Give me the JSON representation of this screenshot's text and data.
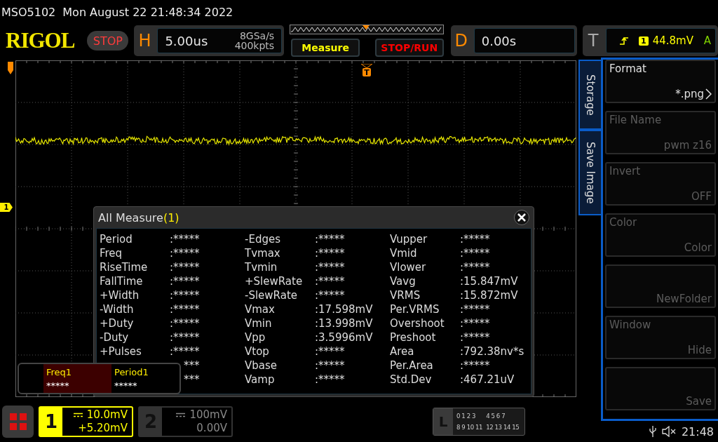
{
  "title_bar": {
    "model": "MSO5102",
    "datetime": "Mon August 22 21:48:34 2022"
  },
  "header": {
    "logo": "RIGOL",
    "run_state": "STOP",
    "horizontal": {
      "label": "H",
      "timebase": "5.00us",
      "sample_rate": "8GSa/s",
      "memory_depth": "400kpts"
    },
    "buttons": [
      {
        "label": "Measure",
        "color": "#ffff00"
      },
      {
        "label": "STOP/RUN",
        "color": "#ff0000"
      }
    ],
    "delay": {
      "label": "D",
      "value": "0.00s"
    },
    "trigger": {
      "label": "T",
      "source": "1",
      "trigger_level": "44.8mV",
      "mode": "A"
    }
  },
  "screen": {
    "trigger_marker": "T",
    "channel_marker": "1"
  },
  "measure_dialog": {
    "title": "All Measure",
    "count": "(1)",
    "columns": [
      [
        {
          "label": "Period",
          "value": ":*****"
        },
        {
          "label": "Freq",
          "value": ":*****"
        },
        {
          "label": "RiseTime",
          "value": ":*****"
        },
        {
          "label": "FallTime",
          "value": ":*****"
        },
        {
          "label": "+Width",
          "value": ":*****"
        },
        {
          "label": "-Width",
          "value": ":*****"
        },
        {
          "label": "+Duty",
          "value": ":*****"
        },
        {
          "label": "-Duty",
          "value": ":*****"
        },
        {
          "label": "+Pulses",
          "value": ":*****"
        },
        {
          "value": "***"
        },
        {
          "value": "***"
        }
      ],
      [
        {
          "label": "-Edges",
          "value": ":*****"
        },
        {
          "label": "Tvmax",
          "value": ":*****"
        },
        {
          "label": "Tvmin",
          "value": ":*****"
        },
        {
          "label": "+SlewRate",
          "value": ":*****"
        },
        {
          "label": "-SlewRate",
          "value": ":*****"
        },
        {
          "label": "Vmax",
          "value": ":17.598mV"
        },
        {
          "label": "Vmin",
          "value": ":13.998mV"
        },
        {
          "label": "Vpp",
          "value": ":3.5996mV"
        },
        {
          "label": "Vtop",
          "value": ":*****"
        },
        {
          "label": "Vbase",
          "value": ":*****"
        },
        {
          "label": "Vamp",
          "value": ":*****"
        }
      ],
      [
        {
          "label": "Vupper",
          "value": ":*****"
        },
        {
          "label": "Vmid",
          "value": ":*****"
        },
        {
          "label": "Vlower",
          "value": ":*****"
        },
        {
          "label": "Vavg",
          "value": ":15.847mV"
        },
        {
          "label": "VRMS",
          "value": ":15.872mV"
        },
        {
          "label": "Per.VRMS",
          "value": ":*****"
        },
        {
          "label": "Overshoot",
          "value": ":*****"
        },
        {
          "label": "Preshoot",
          "value": ":*****"
        },
        {
          "label": "Area",
          "value": ":792.38nv*s"
        },
        {
          "label": "Per.Area",
          "value": ":*****"
        },
        {
          "label": "Std.Dev",
          "value": ":467.21uV"
        }
      ]
    ]
  },
  "statistics": [
    {
      "name": "Freq1",
      "value": "*****",
      "selected": true
    },
    {
      "name": "Period1",
      "value": "*****",
      "selected": false
    }
  ],
  "side_menu": {
    "tabs": [
      "Storage",
      "Save Image"
    ],
    "items": [
      {
        "label": "Format",
        "value": "*.png",
        "disabled": false,
        "has_submenu": true
      },
      {
        "label": "File Name",
        "value": "pwm z16",
        "disabled": true,
        "has_submenu": false
      },
      {
        "label": "Invert",
        "value": "OFF",
        "disabled": true,
        "has_submenu": false
      },
      {
        "label": "Color",
        "value": "Color",
        "disabled": true,
        "has_submenu": false
      },
      {
        "value": "NewFolder",
        "disabled": true,
        "has_submenu": false
      },
      {
        "label": "Window",
        "value": "Hide",
        "disabled": true,
        "has_submenu": false
      },
      {
        "value": "Save",
        "disabled": true,
        "has_submenu": false
      }
    ]
  },
  "channels": [
    {
      "number": "1",
      "scale": "10.0mV",
      "offset": "+5.20mV",
      "selected": true
    },
    {
      "number": "2",
      "scale": "100mV",
      "offset": "0.00V",
      "selected": false
    }
  ],
  "logic": {
    "label": "L",
    "groups": [
      "0 1 2 3",
      "4 5 6 7",
      "8 9 10 11",
      "12 13 14 15"
    ]
  },
  "status": {
    "time": "21:48"
  }
}
